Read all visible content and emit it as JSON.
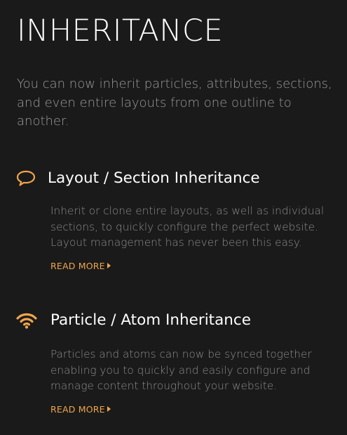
{
  "page": {
    "title": "INHERITANCE",
    "intro": "You can now inherit particles, attributes, sections, and even entire layouts from one outline to another."
  },
  "features": [
    {
      "icon": "speech-bubble-icon",
      "title": "Layout / Section Inheritance",
      "description": "Inherit or clone entire layouts, as well as individual sections, to quickly configure the perfect website. Layout management has never been this easy.",
      "link_label": "READ MORE"
    },
    {
      "icon": "wifi-icon",
      "title": "Particle / Atom Inheritance",
      "description": "Particles and atoms can now be synced together enabling you to quickly and easily configure and manage content throughout your website.",
      "link_label": "READ MORE"
    }
  ],
  "colors": {
    "background": "#1a1a1a",
    "accent": "#f0a54a",
    "heading": "#ffffff",
    "body_text": "#8c8c8c"
  }
}
